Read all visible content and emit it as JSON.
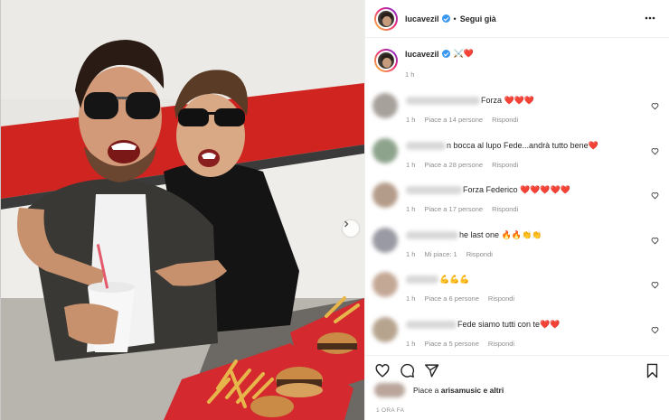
{
  "post": {
    "username": "lucavezil",
    "follow_label": "Segui già",
    "dot": "•",
    "more_icon": "more-horizontal-icon"
  },
  "caption": {
    "username": "lucavezil",
    "text": "⚔️❤️",
    "time": "1 h"
  },
  "comments": [
    {
      "text": "Forza ❤️❤️❤️",
      "time": "1 h",
      "likes": "Piace a 14 persone",
      "reply": "Rispondi"
    },
    {
      "text": "n bocca al lupo Fede...andrà tutto bene❤️",
      "time": "1 h",
      "likes": "Piace a 28 persone",
      "reply": "Rispondi"
    },
    {
      "text": "Forza Federico ❤️❤️❤️❤️❤️",
      "time": "1 h",
      "likes": "Piace a 17 persone",
      "reply": "Rispondi"
    },
    {
      "text": "he last one 🔥🔥👏👏",
      "time": "1 h",
      "likes": "Mi piace: 1",
      "reply": "Rispondi"
    },
    {
      "text": "💪💪💪",
      "time": "1 h",
      "likes": "Piace a 6 persone",
      "reply": "Rispondi"
    },
    {
      "text": "Fede siamo tutti con te❤️❤️",
      "time": "1 h",
      "likes": "Piace a 5 persone",
      "reply": "Rispondi"
    }
  ],
  "actions": {
    "like_icon": "heart-icon",
    "comment_icon": "comment-icon",
    "share_icon": "share-icon",
    "save_icon": "bookmark-icon"
  },
  "likes": {
    "prefix": "Piace a ",
    "user": "arisamusic",
    "suffix": " e altri"
  },
  "timestamp": "1 ORA FA",
  "colors": {
    "text": "#262626",
    "muted": "#8e8e8e",
    "verified": "#3897f0",
    "story_ring": "#ee2a7b"
  }
}
